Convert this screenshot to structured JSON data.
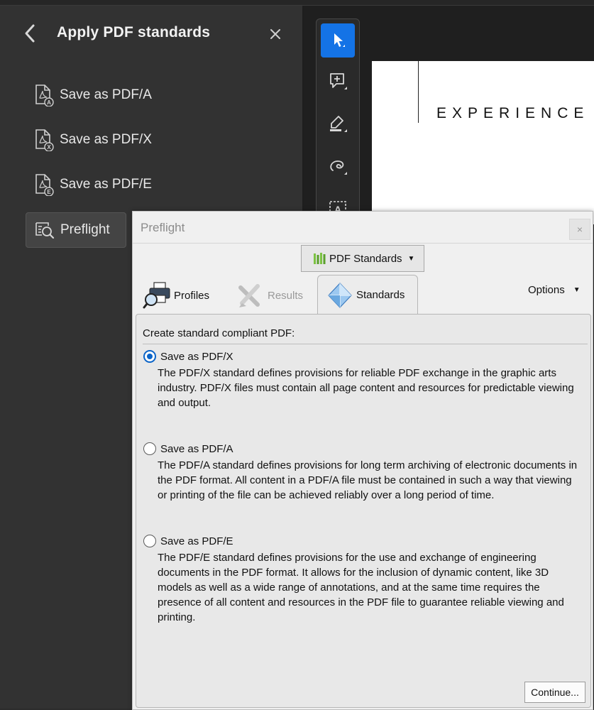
{
  "left_panel": {
    "title": "Apply PDF standards",
    "items": [
      {
        "label": "Save as PDF/A",
        "badge": "A"
      },
      {
        "label": "Save as PDF/X",
        "badge": "X"
      },
      {
        "label": "Save as PDF/E",
        "badge": "E"
      },
      {
        "label": "Preflight"
      }
    ]
  },
  "document": {
    "heading_text": "EXPERIENCE"
  },
  "toolbar": {
    "tools": [
      "select-arrow-icon",
      "add-comment-icon",
      "highlight-pen-icon",
      "lasso-draw-icon",
      "text-recognition-icon"
    ],
    "selected": "select-arrow-icon",
    "accent_color": "#1473e6"
  },
  "dialog": {
    "title": "Preflight",
    "close_label": "×",
    "dropdown_label": "PDF Standards",
    "tabs": {
      "profiles": "Profiles",
      "results": "Results",
      "standards": "Standards"
    },
    "active_tab": "Standards",
    "options_label": "Options",
    "panel_heading": "Create standard compliant PDF:",
    "choices": [
      {
        "title": "Save as PDF/X",
        "checked": true,
        "desc": "The PDF/X standard defines provisions for reliable PDF exchange in the graphic arts industry. PDF/X files must contain all page content and resources for predictable viewing and output."
      },
      {
        "title": "Save as PDF/A",
        "checked": false,
        "desc": "The PDF/A standard defines provisions for long term archiving of electronic documents in the PDF format. All content in a PDF/A file must be contained in such a way that viewing or printing of the file can be achieved reliably over a long period of time."
      },
      {
        "title": "Save as PDF/E",
        "checked": false,
        "desc": "The PDF/E standard defines provisions for the use and exchange of engineering documents in the PDF format. It allows for the inclusion of dynamic content, like 3D models as well as a wide range of annotations, and at the same time requires the presence of all content and resources in the PDF file to guarantee reliable viewing and printing."
      }
    ],
    "continue_label": "Continue..."
  }
}
